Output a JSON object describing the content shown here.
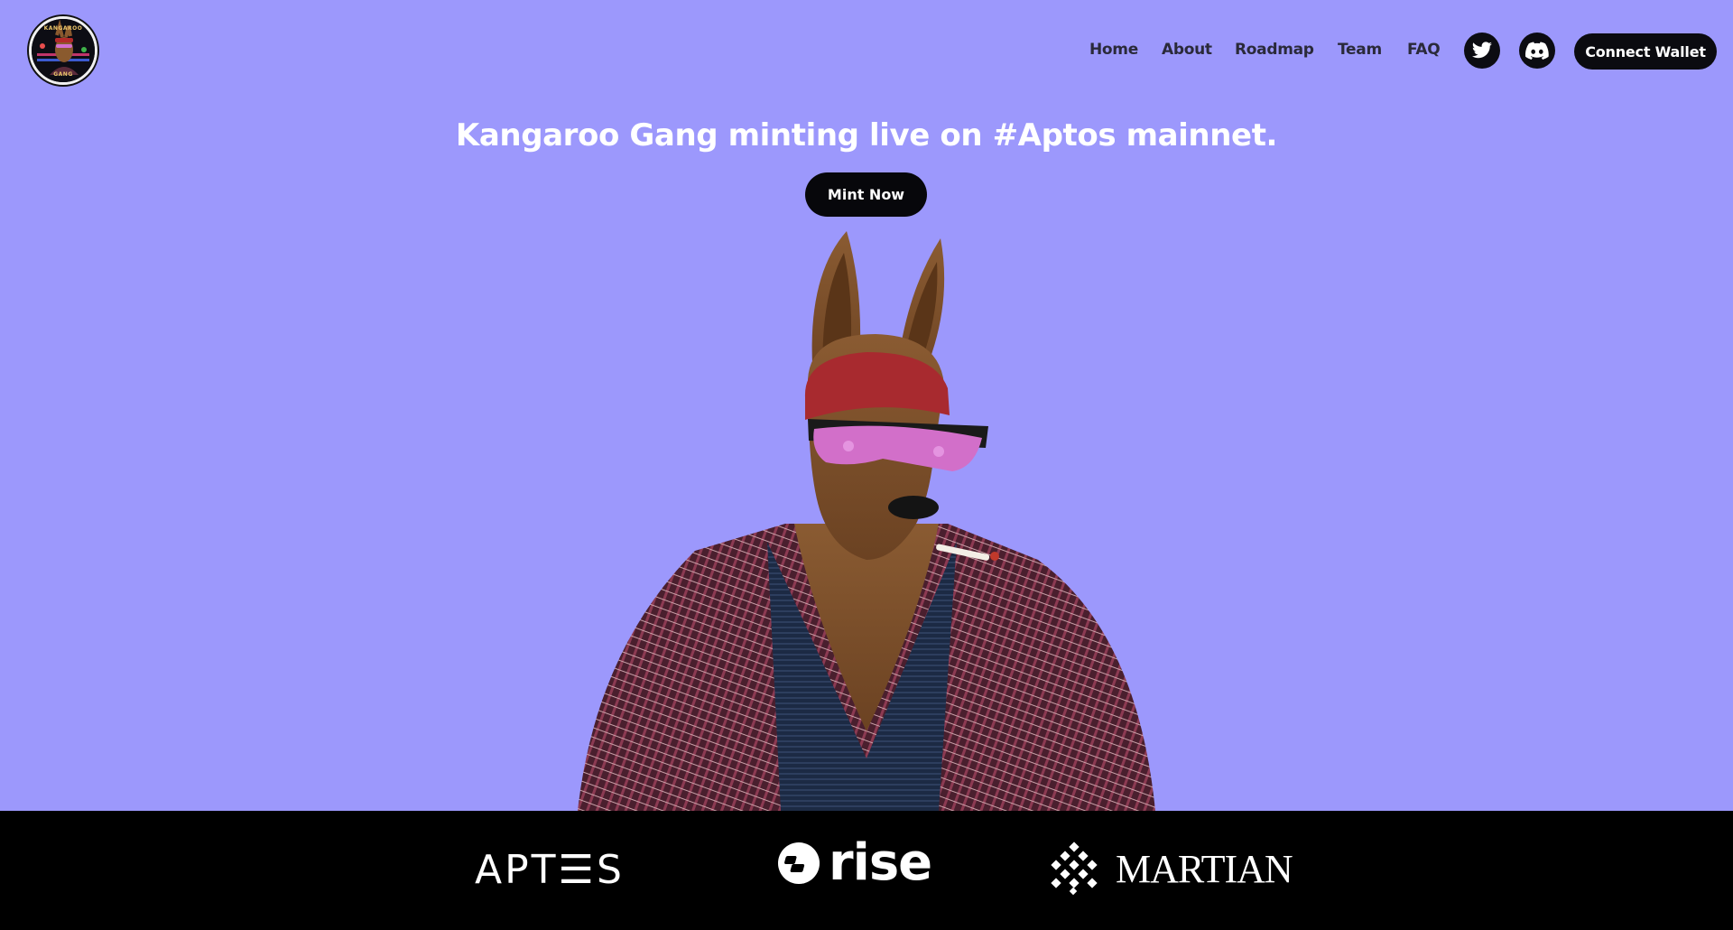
{
  "brand": {
    "logo_icon": "kangaroo-gang-logo",
    "logo_top_text": "KANGAROO",
    "logo_bottom_text": "GANG"
  },
  "nav": {
    "links": [
      "Home",
      "About",
      "Roadmap",
      "Team",
      "FAQ"
    ],
    "social_icons": [
      "twitter-icon",
      "discord-icon"
    ],
    "connect_label": "Connect Wallet"
  },
  "hero": {
    "title": "Kangaroo Gang minting live on #Aptos mainnet.",
    "mint_label": "Mint Now",
    "image_icon": "kangaroo-character-image"
  },
  "partners": {
    "aptos": "APT☰S",
    "rise": "rise",
    "martian": "MARTIAN"
  },
  "colors": {
    "background": "#9c98fc",
    "button": "#07070b",
    "partner_bar": "#000000",
    "text_light": "#ffffff"
  }
}
